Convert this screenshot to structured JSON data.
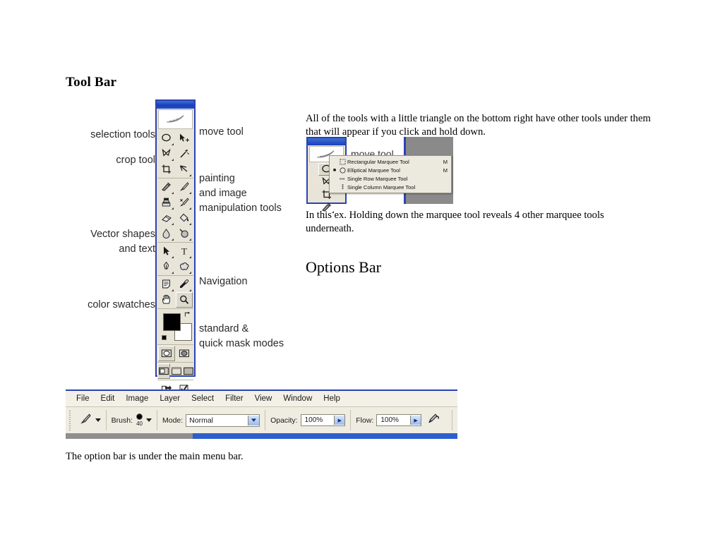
{
  "page": {
    "heading_toolbar": "Tool Bar",
    "heading_options": "Options Bar",
    "para_triangle": "All of the tools with a little triangle on the bottom right have other tools under them that will appear if you click and hold down.",
    "para_inthisex": "In this ex. Holding down the marquee tool reveals 4 other marquee tools underneath.",
    "para_optionunder": "The option bar is under the main menu bar."
  },
  "toolbox_labels": {
    "selection_tools": "selection tools",
    "crop_tool": "crop tool",
    "vector_shapes_and_text": "Vector shapes\nand text",
    "color_swatches": "color swatches",
    "move_tool": "move tool",
    "painting_and_image": "painting\nand image\nmanipulation tools",
    "navigation": "Navigation",
    "mask_modes": "standard &\nquick mask modes"
  },
  "flyout": {
    "move_tool_label": "move tool",
    "items": [
      {
        "label": "Rectangular Marquee Tool",
        "shortcut": "M",
        "checked": false,
        "icon": "rectangular-marquee-icon"
      },
      {
        "label": "Elliptical Marquee Tool",
        "shortcut": "M",
        "checked": true,
        "icon": "elliptical-marquee-icon"
      },
      {
        "label": "Single Row Marquee Tool",
        "shortcut": "",
        "checked": false,
        "icon": "single-row-marquee-icon"
      },
      {
        "label": "Single Column Marquee Tool",
        "shortcut": "",
        "checked": false,
        "icon": "single-column-marquee-icon"
      }
    ]
  },
  "options_bar": {
    "menu_items": [
      "File",
      "Edit",
      "Image",
      "Layer",
      "Select",
      "Filter",
      "View",
      "Window",
      "Help"
    ],
    "brush_label": "Brush:",
    "brush_size": "40",
    "mode_label": "Mode:",
    "mode_value": "Normal",
    "opacity_label": "Opacity:",
    "opacity_value": "100%",
    "flow_label": "Flow:",
    "flow_value": "100%"
  },
  "colors": {
    "photoshop_blue": "#2b43b0",
    "palette_bg": "#e8e4d8",
    "menu_bg": "#ece9de",
    "foreground_swatch": "#000000",
    "background_swatch": "#ffffff"
  }
}
